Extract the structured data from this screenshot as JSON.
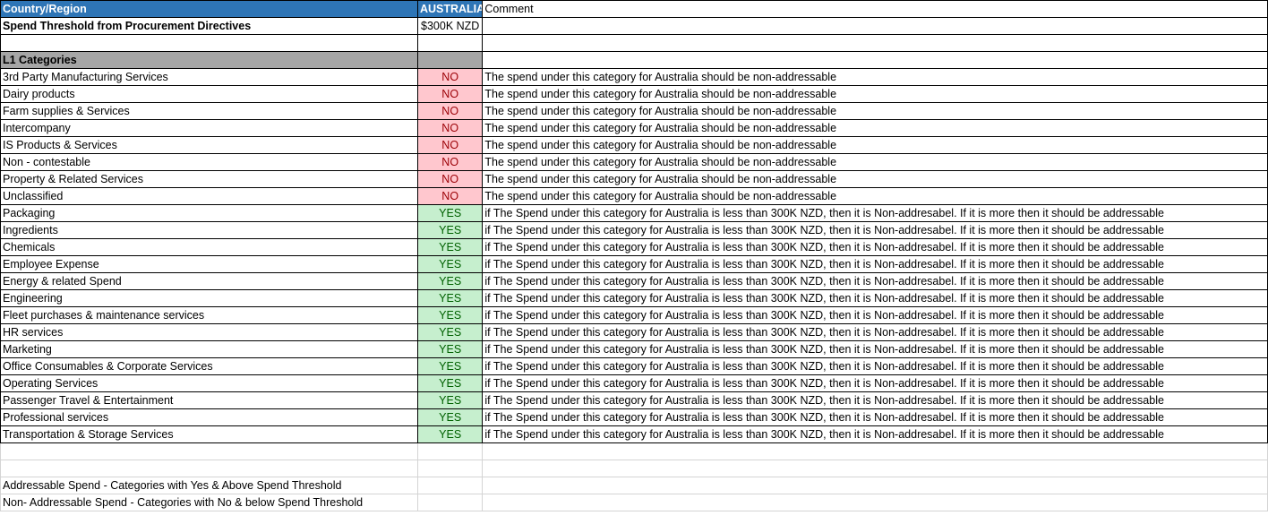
{
  "header": {
    "country_label": "Country/Region",
    "country_value": "AUSTRALIA",
    "comment_label": "Comment",
    "threshold_label": "Spend Threshold from Procurement Directives",
    "threshold_value": "$300K NZD"
  },
  "section_label": "L1 Categories",
  "colors": {
    "header_blue": "#2e75b6",
    "no_fill": "#ffc7ce",
    "yes_fill": "#c6efce",
    "grey_fill": "#a6a6a6"
  },
  "rows": [
    {
      "category": "3rd Party Manufacturing Services",
      "flag": "NO",
      "comment": "The spend under this category for Australia should be non-addressable"
    },
    {
      "category": "Dairy products",
      "flag": "NO",
      "comment": "The spend under this category for Australia should be non-addressable"
    },
    {
      "category": "Farm supplies & Services",
      "flag": "NO",
      "comment": "The spend under this category for Australia should be non-addressable"
    },
    {
      "category": "Intercompany",
      "flag": "NO",
      "comment": "The spend under this category for Australia should be non-addressable"
    },
    {
      "category": "IS Products & Services",
      "flag": "NO",
      "comment": "The spend under this category for Australia should be non-addressable"
    },
    {
      "category": "Non - contestable",
      "flag": "NO",
      "comment": "The spend under this category for Australia should be non-addressable"
    },
    {
      "category": "Property & Related Services",
      "flag": "NO",
      "comment": "The spend under this category for Australia should be non-addressable"
    },
    {
      "category": "Unclassified",
      "flag": "NO",
      "comment": "The spend under this category for Australia should be non-addressable"
    },
    {
      "category": "Packaging",
      "flag": "YES",
      "comment": "if The Spend under this category for Australia is less than 300K NZD, then it is Non-addresabel. If it is more then it should be addressable"
    },
    {
      "category": "Ingredients",
      "flag": "YES",
      "comment": "if The Spend under this category for Australia is less than 300K NZD, then it is Non-addresabel. If it is more then it should be addressable"
    },
    {
      "category": "Chemicals",
      "flag": "YES",
      "comment": "if The Spend under this category for Australia is less than 300K NZD, then it is Non-addresabel. If it is more then it should be addressable"
    },
    {
      "category": "Employee Expense",
      "flag": "YES",
      "comment": "if The Spend under this category for Australia is less than 300K NZD, then it is Non-addresabel. If it is more then it should be addressable"
    },
    {
      "category": "Energy & related Spend",
      "flag": "YES",
      "comment": "if The Spend under this category for Australia is less than 300K NZD, then it is Non-addresabel. If it is more then it should be addressable"
    },
    {
      "category": "Engineering",
      "flag": "YES",
      "comment": "if The Spend under this category for Australia is less than 300K NZD, then it is Non-addresabel. If it is more then it should be addressable"
    },
    {
      "category": "Fleet purchases & maintenance services",
      "flag": "YES",
      "comment": "if The Spend under this category for Australia is less than 300K NZD, then it is Non-addresabel. If it is more then it should be addressable"
    },
    {
      "category": "HR services",
      "flag": "YES",
      "comment": "if The Spend under this category for Australia is less than 300K NZD, then it is Non-addresabel. If it is more then it should be addressable"
    },
    {
      "category": "Marketing",
      "flag": "YES",
      "comment": "if The Spend under this category for Australia is less than 300K NZD, then it is Non-addresabel. If it is more then it should be addressable"
    },
    {
      "category": "Office Consumables & Corporate Services",
      "flag": "YES",
      "comment": "if The Spend under this category for Australia is less than 300K NZD, then it is Non-addresabel. If it is more then it should be addressable"
    },
    {
      "category": "Operating Services",
      "flag": "YES",
      "comment": "if The Spend under this category for Australia is less than 300K NZD, then it is Non-addresabel. If it is more then it should be addressable"
    },
    {
      "category": "Passenger Travel & Entertainment",
      "flag": "YES",
      "comment": "if The Spend under this category for Australia is less than 300K NZD, then it is Non-addresabel. If it is more then it should be addressable"
    },
    {
      "category": "Professional services",
      "flag": "YES",
      "comment": "if The Spend under this category for Australia is less than 300K NZD, then it is Non-addresabel. If it is more then it should be addressable"
    },
    {
      "category": "Transportation & Storage Services",
      "flag": "YES",
      "comment": "if The Spend under this category for Australia is less than 300K NZD, then it is Non-addresabel. If it is more then it should be addressable"
    }
  ],
  "footer": {
    "note_addressable": "Addressable Spend - Categories with Yes & Above Spend Threshold",
    "note_non_addressable": "Non- Addressable Spend - Categories with No & below  Spend Threshold"
  }
}
